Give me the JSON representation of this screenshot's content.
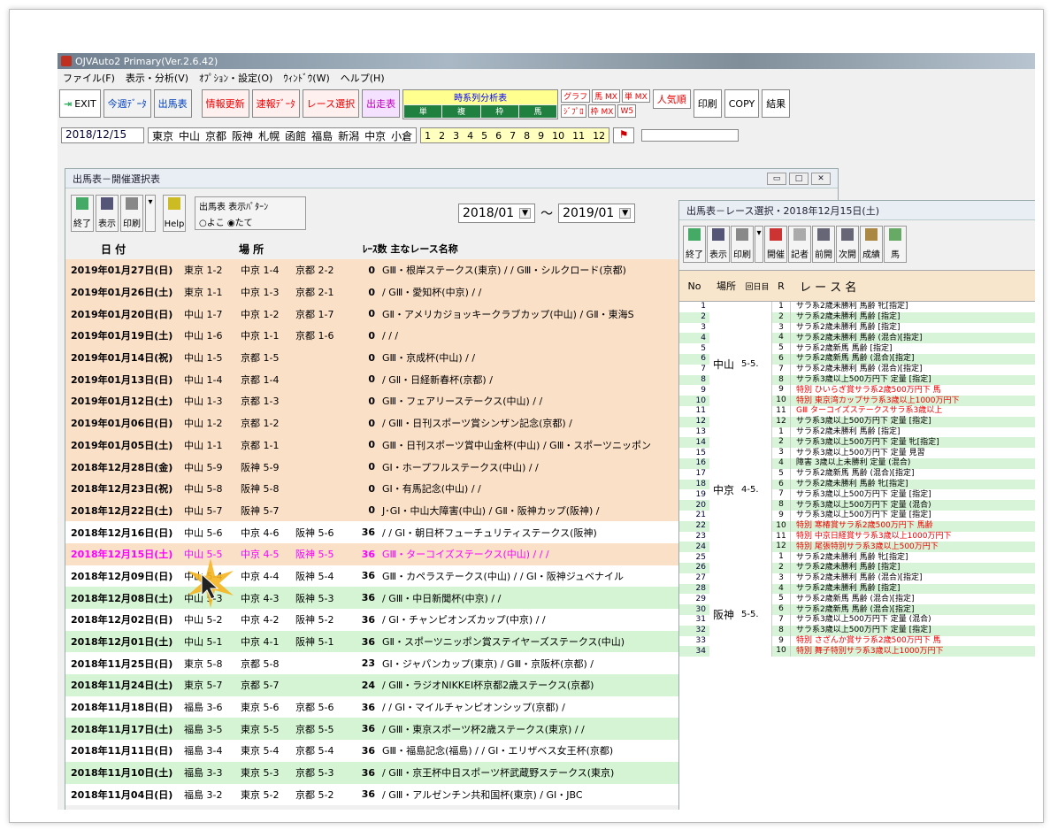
{
  "app": {
    "title": "OJVAuto2 Primary(Ver.2.6.42)",
    "menu": [
      "ファイル(F)",
      "表示・分析(V)",
      "ｵﾌﾟｼｮﾝ・設定(O)",
      "ｳｨﾝﾄﾞｳ(W)",
      "ヘルプ(H)"
    ],
    "toolbar": [
      "EXIT",
      "今週ﾃﾞｰﾀ",
      "出馬表",
      "情報更新",
      "速報ﾃﾞｰﾀ",
      "レース選択",
      "出走表"
    ],
    "jikeiretsu": {
      "title": "時系列分析表",
      "items": [
        "単",
        "複",
        "枠",
        "馬"
      ]
    },
    "mx": [
      [
        "グラフ",
        "馬 MX",
        "単 MX"
      ],
      [
        "ｼﾞﾌﾟﾛ",
        "枠 MX",
        "W5"
      ]
    ],
    "right_buttons": [
      "人気順",
      "印刷",
      "COPY",
      "結果"
    ],
    "date": "2018/12/15",
    "venues": [
      "東京",
      "中山",
      "京都",
      "阪神",
      "札幌",
      "函館",
      "福島",
      "新潟",
      "中京",
      "小倉"
    ],
    "race_nums": [
      "1",
      "2",
      "3",
      "4",
      "5",
      "6",
      "7",
      "8",
      "9",
      "10",
      "11",
      "12"
    ]
  },
  "w1": {
    "title": "出馬表－開催選択表",
    "tools": [
      "終了",
      "表示",
      "印刷",
      "Help"
    ],
    "pattern": {
      "title": "出馬表 表示ﾊﾟﾀｰﾝ",
      "opt1": "よこ",
      "opt2": "たて"
    },
    "from": "2018/01",
    "to": "2019/01",
    "tilde": "～",
    "headers": {
      "date": "日 付",
      "place": "場 所",
      "cnt": "ﾚｰｽ数",
      "main": "主なレース名称"
    },
    "rows": [
      {
        "date": "2019年01月27日(日)",
        "v1": "東京 1-2",
        "v2": "中京 1-4",
        "v3": "京都 2-2",
        "cnt": "0",
        "main": "GⅢ・根岸ステークス(東京) / / GⅢ・シルクロード(京都)",
        "bg": "peach"
      },
      {
        "date": "2019年01月26日(土)",
        "v1": "東京 1-1",
        "v2": "中京 1-3",
        "v3": "京都 2-1",
        "cnt": "0",
        "main": "/ GⅢ・愛知杯(中京) / /",
        "bg": "peach"
      },
      {
        "date": "2019年01月20日(日)",
        "v1": "中山 1-7",
        "v2": "中京 1-2",
        "v3": "京都 1-7",
        "cnt": "0",
        "main": "GⅡ・アメリカジョッキークラブカップ(中山) / GⅡ・東海S",
        "bg": "peach"
      },
      {
        "date": "2019年01月19日(土)",
        "v1": "中山 1-6",
        "v2": "中京 1-1",
        "v3": "京都 1-6",
        "cnt": "0",
        "main": "/ / /",
        "bg": "peach"
      },
      {
        "date": "2019年01月14日(祝)",
        "v1": "中山 1-5",
        "v2": "京都 1-5",
        "v3": "",
        "cnt": "0",
        "main": "GⅢ・京成杯(中山) / /",
        "bg": "peach"
      },
      {
        "date": "2019年01月13日(日)",
        "v1": "中山 1-4",
        "v2": "京都 1-4",
        "v3": "",
        "cnt": "0",
        "main": "/ GⅡ・日経新春杯(京都) /",
        "bg": "peach"
      },
      {
        "date": "2019年01月12日(土)",
        "v1": "中山 1-3",
        "v2": "京都 1-3",
        "v3": "",
        "cnt": "0",
        "main": "GⅢ・フェアリーステークス(中山) / /",
        "bg": "peach"
      },
      {
        "date": "2019年01月06日(日)",
        "v1": "中山 1-2",
        "v2": "京都 1-2",
        "v3": "",
        "cnt": "0",
        "main": "/ GⅢ・日刊スポーツ賞シンザン記念(京都) /",
        "bg": "peach"
      },
      {
        "date": "2019年01月05日(土)",
        "v1": "中山 1-1",
        "v2": "京都 1-1",
        "v3": "",
        "cnt": "0",
        "main": "GⅢ・日刊スポーツ賞中山金杯(中山) / GⅢ・スポーツニッポン",
        "bg": "peach"
      },
      {
        "date": "2018年12月28日(金)",
        "v1": "中山 5-9",
        "v2": "阪神 5-9",
        "v3": "",
        "cnt": "0",
        "main": "GⅠ・ホープフルステークス(中山) / /",
        "bg": "peach"
      },
      {
        "date": "2018年12月23日(祝)",
        "v1": "中山 5-8",
        "v2": "阪神 5-8",
        "v3": "",
        "cnt": "0",
        "main": "GⅠ・有馬記念(中山) / /",
        "bg": "peach"
      },
      {
        "date": "2018年12月22日(土)",
        "v1": "中山 5-7",
        "v2": "阪神 5-7",
        "v3": "",
        "cnt": "0",
        "main": "J･GⅠ・中山大障害(中山) / GⅡ・阪神カップ(阪神) /",
        "bg": "peach"
      },
      {
        "date": "2018年12月16日(日)",
        "v1": "中山 5-6",
        "v2": "中京 4-6",
        "v3": "阪神 5-6",
        "cnt": "36",
        "main": "/ / GⅠ・朝日杯フューチュリティステークス(阪神)",
        "bg": "white"
      },
      {
        "date": "2018年12月15日(土)",
        "v1": "中山 5-5",
        "v2": "中京 4-5",
        "v3": "阪神 5-5",
        "cnt": "36",
        "main": "GⅢ・ターコイズステークス(中山) / / /",
        "bg": "sel"
      },
      {
        "date": "2018年12月09日(日)",
        "v1": "中山 5-4",
        "v2": "中京 4-4",
        "v3": "阪神 5-4",
        "cnt": "36",
        "main": "GⅢ・カペラステークス(中山) / / GⅠ・阪神ジュベナイル",
        "bg": "white"
      },
      {
        "date": "2018年12月08日(土)",
        "v1": "中山 5-3",
        "v2": "中京 4-3",
        "v3": "阪神 5-3",
        "cnt": "36",
        "main": "/ GⅢ・中日新聞杯(中京) / /",
        "bg": "green"
      },
      {
        "date": "2018年12月02日(日)",
        "v1": "中山 5-2",
        "v2": "中京 4-2",
        "v3": "阪神 5-2",
        "cnt": "36",
        "main": "/ GⅠ・チャンピオンズカップ(中京) / /",
        "bg": "white"
      },
      {
        "date": "2018年12月01日(土)",
        "v1": "中山 5-1",
        "v2": "中京 4-1",
        "v3": "阪神 5-1",
        "cnt": "36",
        "main": "GⅡ・スポーツニッポン賞ステイヤーズステークス(中山)",
        "bg": "green"
      },
      {
        "date": "2018年11月25日(日)",
        "v1": "東京 5-8",
        "v2": "京都 5-8",
        "v3": "",
        "cnt": "23",
        "main": "GⅠ・ジャパンカップ(東京) / GⅢ・京阪杯(京都) /",
        "bg": "white"
      },
      {
        "date": "2018年11月24日(土)",
        "v1": "東京 5-7",
        "v2": "京都 5-7",
        "v3": "",
        "cnt": "24",
        "main": "/ GⅢ・ラジオNIKKEI杯京都2歳ステークス(京都)",
        "bg": "green"
      },
      {
        "date": "2018年11月18日(日)",
        "v1": "福島 3-6",
        "v2": "東京 5-6",
        "v3": "京都 5-6",
        "cnt": "36",
        "main": "/ / GⅠ・マイルチャンピオンシップ(京都) /",
        "bg": "white"
      },
      {
        "date": "2018年11月17日(土)",
        "v1": "福島 3-5",
        "v2": "東京 5-5",
        "v3": "京都 5-5",
        "cnt": "36",
        "main": "/ GⅢ・東京スポーツ杯2歳ステークス(東京) / /",
        "bg": "green"
      },
      {
        "date": "2018年11月11日(日)",
        "v1": "福島 3-4",
        "v2": "東京 5-4",
        "v3": "京都 5-4",
        "cnt": "36",
        "main": "GⅢ・福島記念(福島) / / GⅠ・エリザベス女王杯(京都)",
        "bg": "white"
      },
      {
        "date": "2018年11月10日(土)",
        "v1": "福島 3-3",
        "v2": "東京 5-3",
        "v3": "京都 5-3",
        "cnt": "36",
        "main": "/ GⅢ・京王杯中日スポーツ杯武蔵野ステークス(東京)",
        "bg": "green"
      },
      {
        "date": "2018年11月04日(日)",
        "v1": "福島 3-2",
        "v2": "東京 5-2",
        "v3": "京都 5-2",
        "cnt": "36",
        "main": "/ GⅢ・アルゼンチン共和国杯(東京) / GⅠ・JBC",
        "bg": "white"
      }
    ]
  },
  "w2": {
    "title": "出馬表－レース選択・2018年12月15日(土)",
    "tools": [
      "終了",
      "表示",
      "印刷",
      "開催",
      "記者",
      "前開",
      "次開",
      "成績",
      "馬"
    ],
    "headers": {
      "no": "No",
      "place": "場所",
      "day": "回日目",
      "r": "R",
      "name": "レ ー ス 名"
    },
    "venues": [
      {
        "name": "中山",
        "day": "5-5."
      },
      {
        "name": "中京",
        "day": "4-5."
      },
      {
        "name": "阪神",
        "day": "5-5."
      }
    ],
    "races": [
      "サラ系2歳未勝利 馬齢 牝[指定]",
      "サラ系2歳未勝利 馬齢 [指定]",
      "サラ系2歳未勝利 馬齢 [指定]",
      "サラ系2歳未勝利 馬齢 (混合)[指定]",
      "サラ系2歳新馬 馬齢 [指定]",
      "サラ系2歳新馬 馬齢 (混合)[指定]",
      "サラ系2歳未勝利 馬齢 (混合)[指定]",
      "サラ系3歳以上500万円下 定量 [指定]",
      "特別 ひいらぎ賞サラ系2歳500万円下 馬",
      "特別 東京湾カップサラ系3歳以上1000万円下",
      "GⅢ ターコイズステークスサラ系3歳以上",
      "サラ系3歳以上500万円下 定量 [指定]",
      "サラ系2歳未勝利 馬齢 [指定]",
      "サラ系3歳以上500万円下 定量 牝[指定]",
      "サラ系3歳以上500万円下 定量 見習",
      "障害 3歳以上未勝利 定量 (混合)",
      "サラ系2歳新馬 馬齢 (混合)[指定]",
      "サラ系2歳未勝利 馬齢 牝[指定]",
      "サラ系3歳以上500万円下 定量 [指定]",
      "サラ系3歳以上500万円下 定量 (混合)",
      "サラ系3歳以上500万円下 定量 [指定]",
      "特別 寒椿賞サラ系2歳500万円下 馬齢",
      "特別 中京日経賞サラ系3歳以上1000万円下",
      "特別 尾張特別サラ系3歳以上500万円下",
      "サラ系2歳未勝利 馬齢 牝[指定]",
      "サラ系2歳未勝利 馬齢 [指定]",
      "サラ系2歳未勝利 馬齢 (混合)[指定]",
      "サラ系2歳未勝利 馬齢 [指定]",
      "サラ系2歳新馬 馬齢 (混合)[指定]",
      "サラ系2歳新馬 馬齢 (混合)[指定]",
      "サラ系3歳以上500万円下 定量 (混合)",
      "サラ系3歳以上500万円下 定量 [指定]",
      "特別 さざんか賞サラ系2歳500万円下 馬",
      "特別 舞子特別サラ系3歳以上1000万円下"
    ],
    "red": [
      9,
      10,
      11,
      22,
      23,
      24,
      33,
      34
    ],
    "green": [
      2,
      4,
      6,
      8,
      10,
      12,
      14,
      16,
      18,
      20,
      22,
      24,
      26,
      28,
      30,
      32,
      34
    ]
  }
}
